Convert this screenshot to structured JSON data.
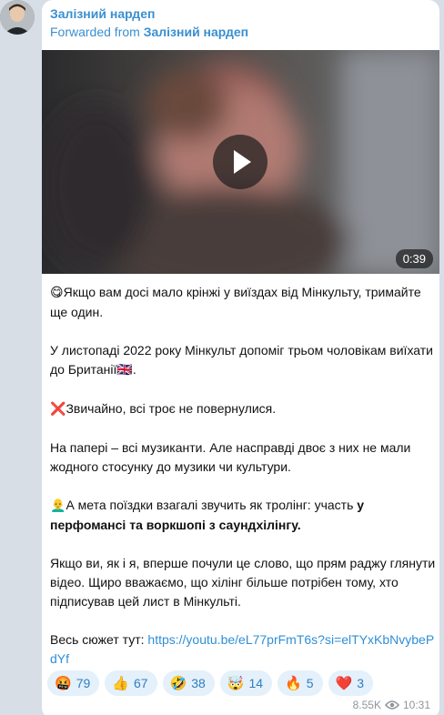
{
  "post": {
    "sender": "Залізний нардеп",
    "forwarded_prefix": "Forwarded from",
    "forwarded_source": "Залізний нардеп"
  },
  "video": {
    "duration": "0:39"
  },
  "message": {
    "p1_emoji": "😋",
    "p1": "Якщо вам досі мало крінжі у виїздах від Мінкульту, тримайте ще один.",
    "p2": "У листопаді 2022 року Мінкульт допоміг трьом чоловікам виїхати до Британії",
    "p2_flag": "🇬🇧",
    "p2_end": ".",
    "p3_emoji": "❌",
    "p3": "Звичайно, всі троє не повернулися.",
    "p4": "На папері – всі музиканти. Але насправді двоє з них не мали жодного стосунку до музики чи культури.",
    "p5_emoji": "👨‍🦲",
    "p5_start": "А мета поїздки взагалі звучить як тролінг: участь ",
    "p5_bold": "у перфомансі та воркшопі з саундхілінгу.",
    "p6": "Якщо ви, як і я, вперше почули це слово, що прям раджу глянути відео. Щиро вважаємо, що хілінг більше потрібен тому, хто підписував цей лист в Мінкульті.",
    "p7_label": "Весь сюжет тут: ",
    "p7_link": "https://youtu.be/eL77prFmT6s?si=elTYxKbNvybePdYf"
  },
  "reactions": [
    {
      "emoji": "🤬",
      "count": "79"
    },
    {
      "emoji": "👍",
      "count": "67"
    },
    {
      "emoji": "🤣",
      "count": "38"
    },
    {
      "emoji": "🤯",
      "count": "14"
    },
    {
      "emoji": "🔥",
      "count": "5"
    },
    {
      "emoji": "❤️",
      "count": "3"
    }
  ],
  "meta": {
    "views": "8.55K",
    "time": "10:31"
  },
  "icons": {
    "play": "play-icon",
    "views": "eye-icon"
  },
  "colors": {
    "accent": "#3a8fd0",
    "reaction_bg": "#e4f0fa",
    "link": "#2f8fd6"
  }
}
